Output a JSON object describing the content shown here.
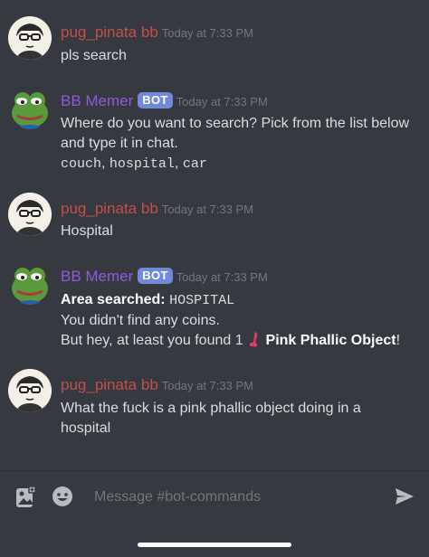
{
  "channel": "bot-commands",
  "messages": [
    {
      "author": "pug_pinata bb",
      "author_color": "#c0504c",
      "is_bot": false,
      "timestamp": "Today at 7:33 PM",
      "lines": [
        "pls search"
      ]
    },
    {
      "author": "BB Memer",
      "author_color": "#8c5bd6",
      "is_bot": true,
      "badge": "BOT",
      "timestamp": "Today at 7:33 PM",
      "lines": [
        "Where do you want to search? Pick from the list below",
        "and type it in chat."
      ],
      "options": [
        "couch",
        "hospital",
        "car"
      ],
      "separator": ", "
    },
    {
      "author": "pug_pinata bb",
      "author_color": "#c0504c",
      "is_bot": false,
      "timestamp": "Today at 7:33 PM",
      "lines": [
        "Hospital"
      ]
    },
    {
      "author": "BB Memer",
      "author_color": "#8c5bd6",
      "is_bot": true,
      "badge": "BOT",
      "timestamp": "Today at 7:33 PM",
      "area_label": "Area searched:",
      "area_value": "HOSPITAL",
      "line2": "You didn't find any coins.",
      "line3_prefix": "But hey, at least you found 1",
      "item_name": "Pink Phallic Object",
      "line3_suffix": "!",
      "item_icon": "pink-object-icon"
    },
    {
      "author": "pug_pinata bb",
      "author_color": "#c0504c",
      "is_bot": false,
      "timestamp": "Today at 7:33 PM",
      "lines": [
        "What the fuck is a pink phallic object doing in a",
        "hospital"
      ]
    }
  ],
  "composer": {
    "placeholder": "Message #bot-commands",
    "icons": [
      "gallery-icon",
      "emoji-icon",
      "send-icon"
    ]
  },
  "colors": {
    "background": "#36393f",
    "bot_badge": "#7289da",
    "timestamp": "#72767d"
  }
}
